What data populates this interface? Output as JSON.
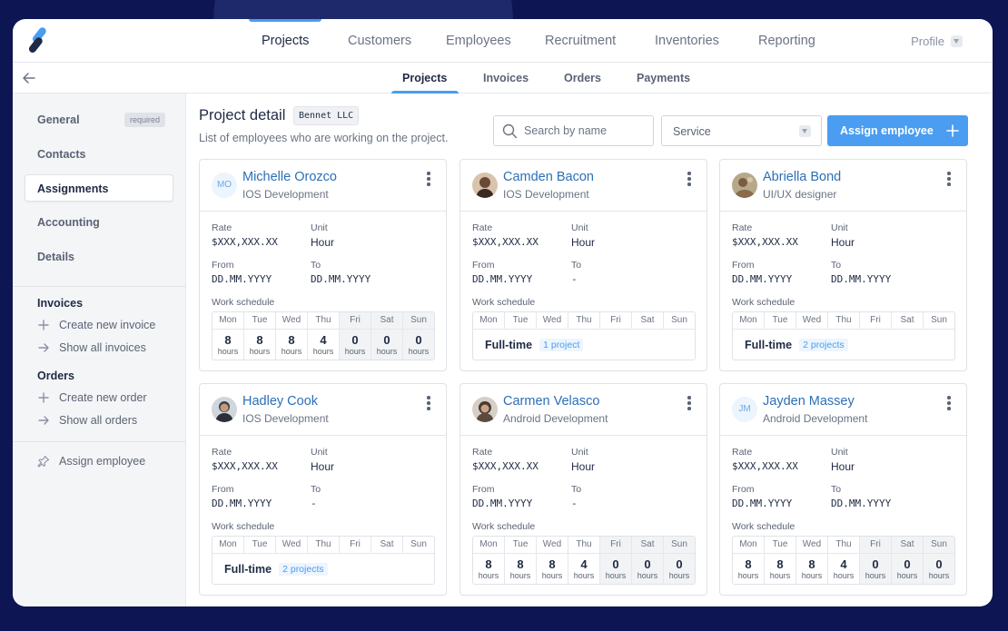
{
  "topnav": {
    "items": [
      "Projects",
      "Customers",
      "Employees",
      "Recruitment",
      "Inventories",
      "Reporting"
    ],
    "profile": "Profile"
  },
  "subnav": {
    "items": [
      "Projects",
      "Invoices",
      "Orders",
      "Payments"
    ]
  },
  "sidebar": {
    "items": [
      "General",
      "Contacts",
      "Assignments",
      "Accounting",
      "Details"
    ],
    "required_badge": "required",
    "invoices": {
      "title": "Invoices",
      "create": "Create new invoice",
      "show": "Show all invoices"
    },
    "orders": {
      "title": "Orders",
      "create": "Create new order",
      "show": "Show all orders"
    },
    "assign": "Assign employee"
  },
  "main": {
    "title": "Project detail",
    "client": "Bennet LLC",
    "description": "List of employees who are working on the project.",
    "search_placeholder": "Search by name",
    "service_select": "Service",
    "assign_button": "Assign employee"
  },
  "labels": {
    "rate": "Rate",
    "unit": "Unit",
    "from": "From",
    "to": "To",
    "work_schedule": "Work schedule",
    "hours_unit": "hours",
    "days": [
      "Mon",
      "Tue",
      "Wed",
      "Thu",
      "Fri",
      "Sat",
      "Sun"
    ]
  },
  "cards": [
    {
      "name": "Michelle Orozco",
      "initials": "MO",
      "role": "IOS Development",
      "rate": "$XXX,XXX.XX",
      "unit": "Hour",
      "from": "DD.MM.YYYY",
      "to": "DD.MM.YYYY",
      "schedule_type": "hours",
      "hours": [
        "8",
        "8",
        "8",
        "4",
        "0",
        "0",
        "0"
      ]
    },
    {
      "name": "Camden Bacon",
      "initials": "",
      "role": "IOS Development",
      "rate": "$XXX,XXX.XX",
      "unit": "Hour",
      "from": "DD.MM.YYYY",
      "to": "-",
      "schedule_type": "fulltime",
      "fulltime_label": "Full-time",
      "projects": "1 project"
    },
    {
      "name": "Abriella Bond",
      "initials": "",
      "role": "UI/UX designer",
      "rate": "$XXX,XXX.XX",
      "unit": "Hour",
      "from": "DD.MM.YYYY",
      "to": "DD.MM.YYYY",
      "schedule_type": "fulltime",
      "fulltime_label": "Full-time",
      "projects": "2 projects"
    },
    {
      "name": "Hadley Cook",
      "initials": "",
      "role": "IOS Development",
      "rate": "$XXX,XXX.XX",
      "unit": "Hour",
      "from": "DD.MM.YYYY",
      "to": "-",
      "schedule_type": "fulltime",
      "fulltime_label": "Full-time",
      "projects": "2 projects"
    },
    {
      "name": "Carmen Velasco",
      "initials": "",
      "role": "Android Development",
      "rate": "$XXX,XXX.XX",
      "unit": "Hour",
      "from": "DD.MM.YYYY",
      "to": "-",
      "schedule_type": "hours",
      "hours": [
        "8",
        "8",
        "8",
        "4",
        "0",
        "0",
        "0"
      ]
    },
    {
      "name": "Jayden Massey",
      "initials": "JM",
      "role": "Android Development",
      "rate": "$XXX,XXX.XX",
      "unit": "Hour",
      "from": "DD.MM.YYYY",
      "to": "DD.MM.YYYY",
      "schedule_type": "hours",
      "hours": [
        "8",
        "8",
        "8",
        "4",
        "0",
        "0",
        "0"
      ]
    }
  ],
  "colors": {
    "accent": "#4a9df0",
    "link": "#2b6fb6",
    "background": "#0d1652"
  }
}
